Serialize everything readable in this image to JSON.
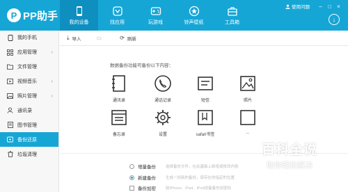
{
  "app": {
    "logo_mark": "P",
    "logo_text": "PP助手",
    "feedback": "使用问题",
    "win_minimize": "–",
    "win_maximize": "□",
    "win_close": "×",
    "download_glyph": "↓"
  },
  "nav": [
    {
      "label": "我的设备",
      "icon": "phone-icon",
      "active": true
    },
    {
      "label": "找应用",
      "icon": "app-store-icon",
      "active": false
    },
    {
      "label": "玩游戏",
      "icon": "gamepad-icon",
      "active": false
    },
    {
      "label": "铃声壁纸",
      "icon": "star-icon",
      "active": false
    },
    {
      "label": "工具箱",
      "icon": "toolbox-icon",
      "active": false
    }
  ],
  "sidebar": {
    "items": [
      {
        "label": "我的手机",
        "icon": "phone-icon"
      },
      {
        "label": "应用管理",
        "icon": "apps-icon"
      },
      {
        "label": "文件管理",
        "icon": "folder-icon"
      },
      {
        "label": "视频音乐",
        "icon": "video-icon"
      },
      {
        "label": "照片管理",
        "icon": "photo-icon"
      },
      {
        "label": "通讯录",
        "icon": "contacts-icon"
      },
      {
        "label": "图书管理",
        "icon": "book-icon"
      },
      {
        "label": "备份还原",
        "icon": "backup-icon",
        "active": true
      },
      {
        "label": "垃圾清理",
        "icon": "cleanup-icon"
      }
    ],
    "chev": "›"
  },
  "toolbar": {
    "import_label": "导入",
    "import_icon": "⤓",
    "disabled_icon": "▭",
    "refresh_label": "刷新",
    "refresh_icon": "⟳"
  },
  "content": {
    "prompt": "数据备份功能可备份以下内容：",
    "items": [
      {
        "label": "通讯录",
        "icon": "address-book-icon"
      },
      {
        "label": "通话记录",
        "icon": "call-log-icon"
      },
      {
        "label": "短信",
        "icon": "sms-icon"
      },
      {
        "label": "照片",
        "icon": "photo-icon"
      },
      {
        "label": "备忘录",
        "icon": "memo-icon"
      },
      {
        "label": "设置",
        "icon": "settings-icon"
      },
      {
        "label": "safari书签",
        "icon": "bookmark-icon"
      },
      {
        "label": "...",
        "icon": "more-icon"
      }
    ]
  },
  "options": {
    "incremental_label": "增量备份",
    "incremental_desc": "选择备份文件，在此基础上新增或修改内容",
    "new_label": "新建备份",
    "new_desc": "生成一份新的备份，保存在你指定的位置",
    "encrypt_label": "备份加密",
    "encrypt_desc": "给iPhone、iPad、iPod设备备份加密码"
  },
  "watermark": {
    "title": "百科全说",
    "subtitle": "助你轻松解决"
  },
  "colors": {
    "accent": "#16a6d6",
    "nav_active": "#0e8fc0",
    "icon_stroke": "#333333"
  }
}
